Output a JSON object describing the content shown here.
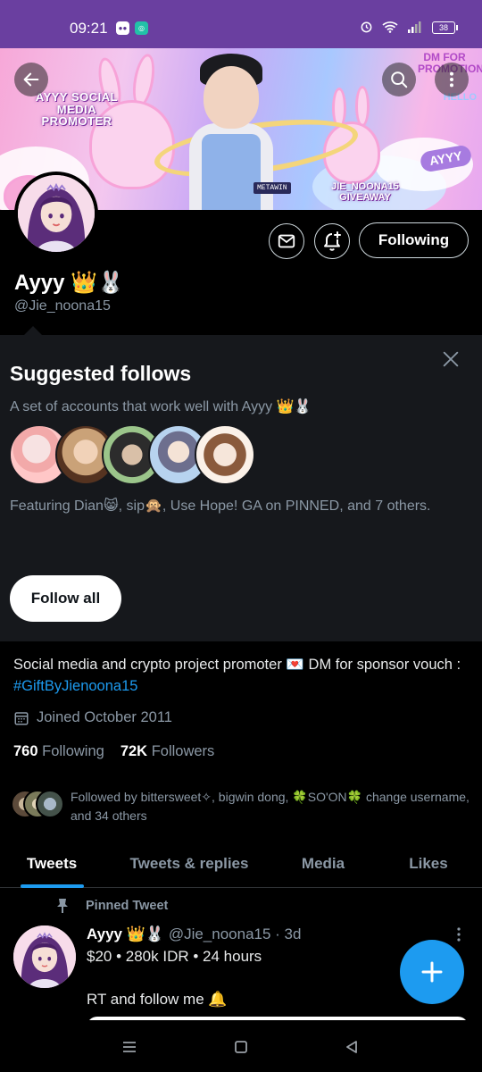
{
  "status_bar": {
    "time": "09:21",
    "battery": "38",
    "notification_icons": [
      "chat-bubble-icon",
      "teal-app-icon"
    ],
    "right_icons": [
      "alarm-icon",
      "wifi-icon",
      "signal-icon",
      "battery-icon"
    ]
  },
  "banner": {
    "text_left": "AYYY SOCIAL MEDIA PROMOTER",
    "text_top_right": "DM FOR PROMOTION",
    "text_bottom_right": "JIE_NOONA15 GIVEAWAY",
    "badge": "AYYY",
    "name_tag": "METAWIN",
    "hello_sign": "HELLO"
  },
  "header": {
    "back_icon": "arrow-left-icon",
    "search_icon": "search-icon",
    "more_icon": "more-vertical-icon"
  },
  "profile": {
    "name": "Ayyy 👑🐰",
    "handle": "@Jie_noona15",
    "following_label": "Following",
    "message_icon": "envelope-icon",
    "notify_icon": "bell-plus-icon"
  },
  "suggested": {
    "title": "Suggested follows",
    "subtitle": "A set of accounts that work well with Ayyy 👑🐰",
    "featuring": "Featuring Dian😸, sip🙊, Use Hope! GA on PINNED, and 7 others.",
    "follow_all_label": "Follow all",
    "avatar_count": 5
  },
  "bio": {
    "text": "Social media and crypto project promoter 💌 DM for sponsor vouch : ",
    "hashtag": "#GiftByJienoona15"
  },
  "meta": {
    "joined": "Joined October 2011",
    "following_count": "760",
    "following_label": "Following",
    "followers_count": "72K",
    "followers_label": "Followers"
  },
  "followed_by": {
    "text": "Followed by bittersweet✧, bigwin dong, 🍀SO'ON🍀 change username, and 34 others"
  },
  "tabs": [
    {
      "label": "Tweets",
      "active": true
    },
    {
      "label": "Tweets & replies",
      "active": false
    },
    {
      "label": "Media",
      "active": false
    },
    {
      "label": "Likes",
      "active": false
    }
  ],
  "tweet": {
    "pinned_label": "Pinned Tweet",
    "name": "Ayyy 👑🐰",
    "handle_time": "@Jie_noona15 · 3d",
    "line1": "$20 • 280k IDR • 24 hours",
    "line2": "RT and follow me 🔔"
  },
  "colors": {
    "accent": "#1d9bf0",
    "background": "#000000",
    "panel": "#16181c",
    "secondary_text": "#8b98a5",
    "status_bar": "#6a3fa0"
  }
}
